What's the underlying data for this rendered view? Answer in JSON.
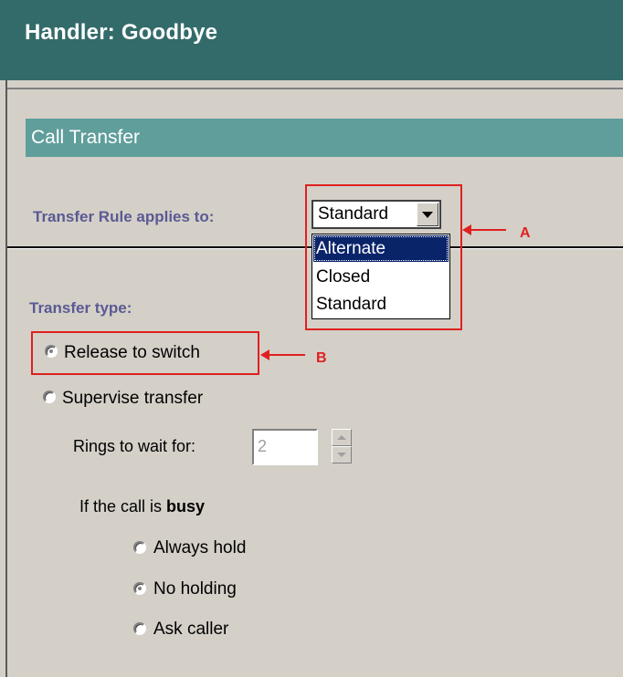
{
  "header": {
    "title": "Handler: Goodbye"
  },
  "section": {
    "title": "Call Transfer"
  },
  "transfer_rule": {
    "label": "Transfer Rule applies to:",
    "selected": "Standard",
    "options": [
      "Alternate",
      "Closed",
      "Standard"
    ],
    "highlighted": "Alternate"
  },
  "transfer_type": {
    "label": "Transfer type:",
    "release": "Release to switch",
    "supervise": "Supervise transfer"
  },
  "rings": {
    "label": "Rings to wait for:",
    "value": "2"
  },
  "busy": {
    "prefix": "If the call is ",
    "bold": "busy",
    "always_hold": "Always hold",
    "no_holding": "No holding",
    "ask_caller": "Ask caller"
  },
  "annotations": {
    "a": "A",
    "b": "B"
  },
  "colors": {
    "header_bg": "#336b6a",
    "section_bg": "#5f9e9b",
    "label": "#5a5a94",
    "annotation": "#e02020",
    "selection": "#0a246a"
  }
}
